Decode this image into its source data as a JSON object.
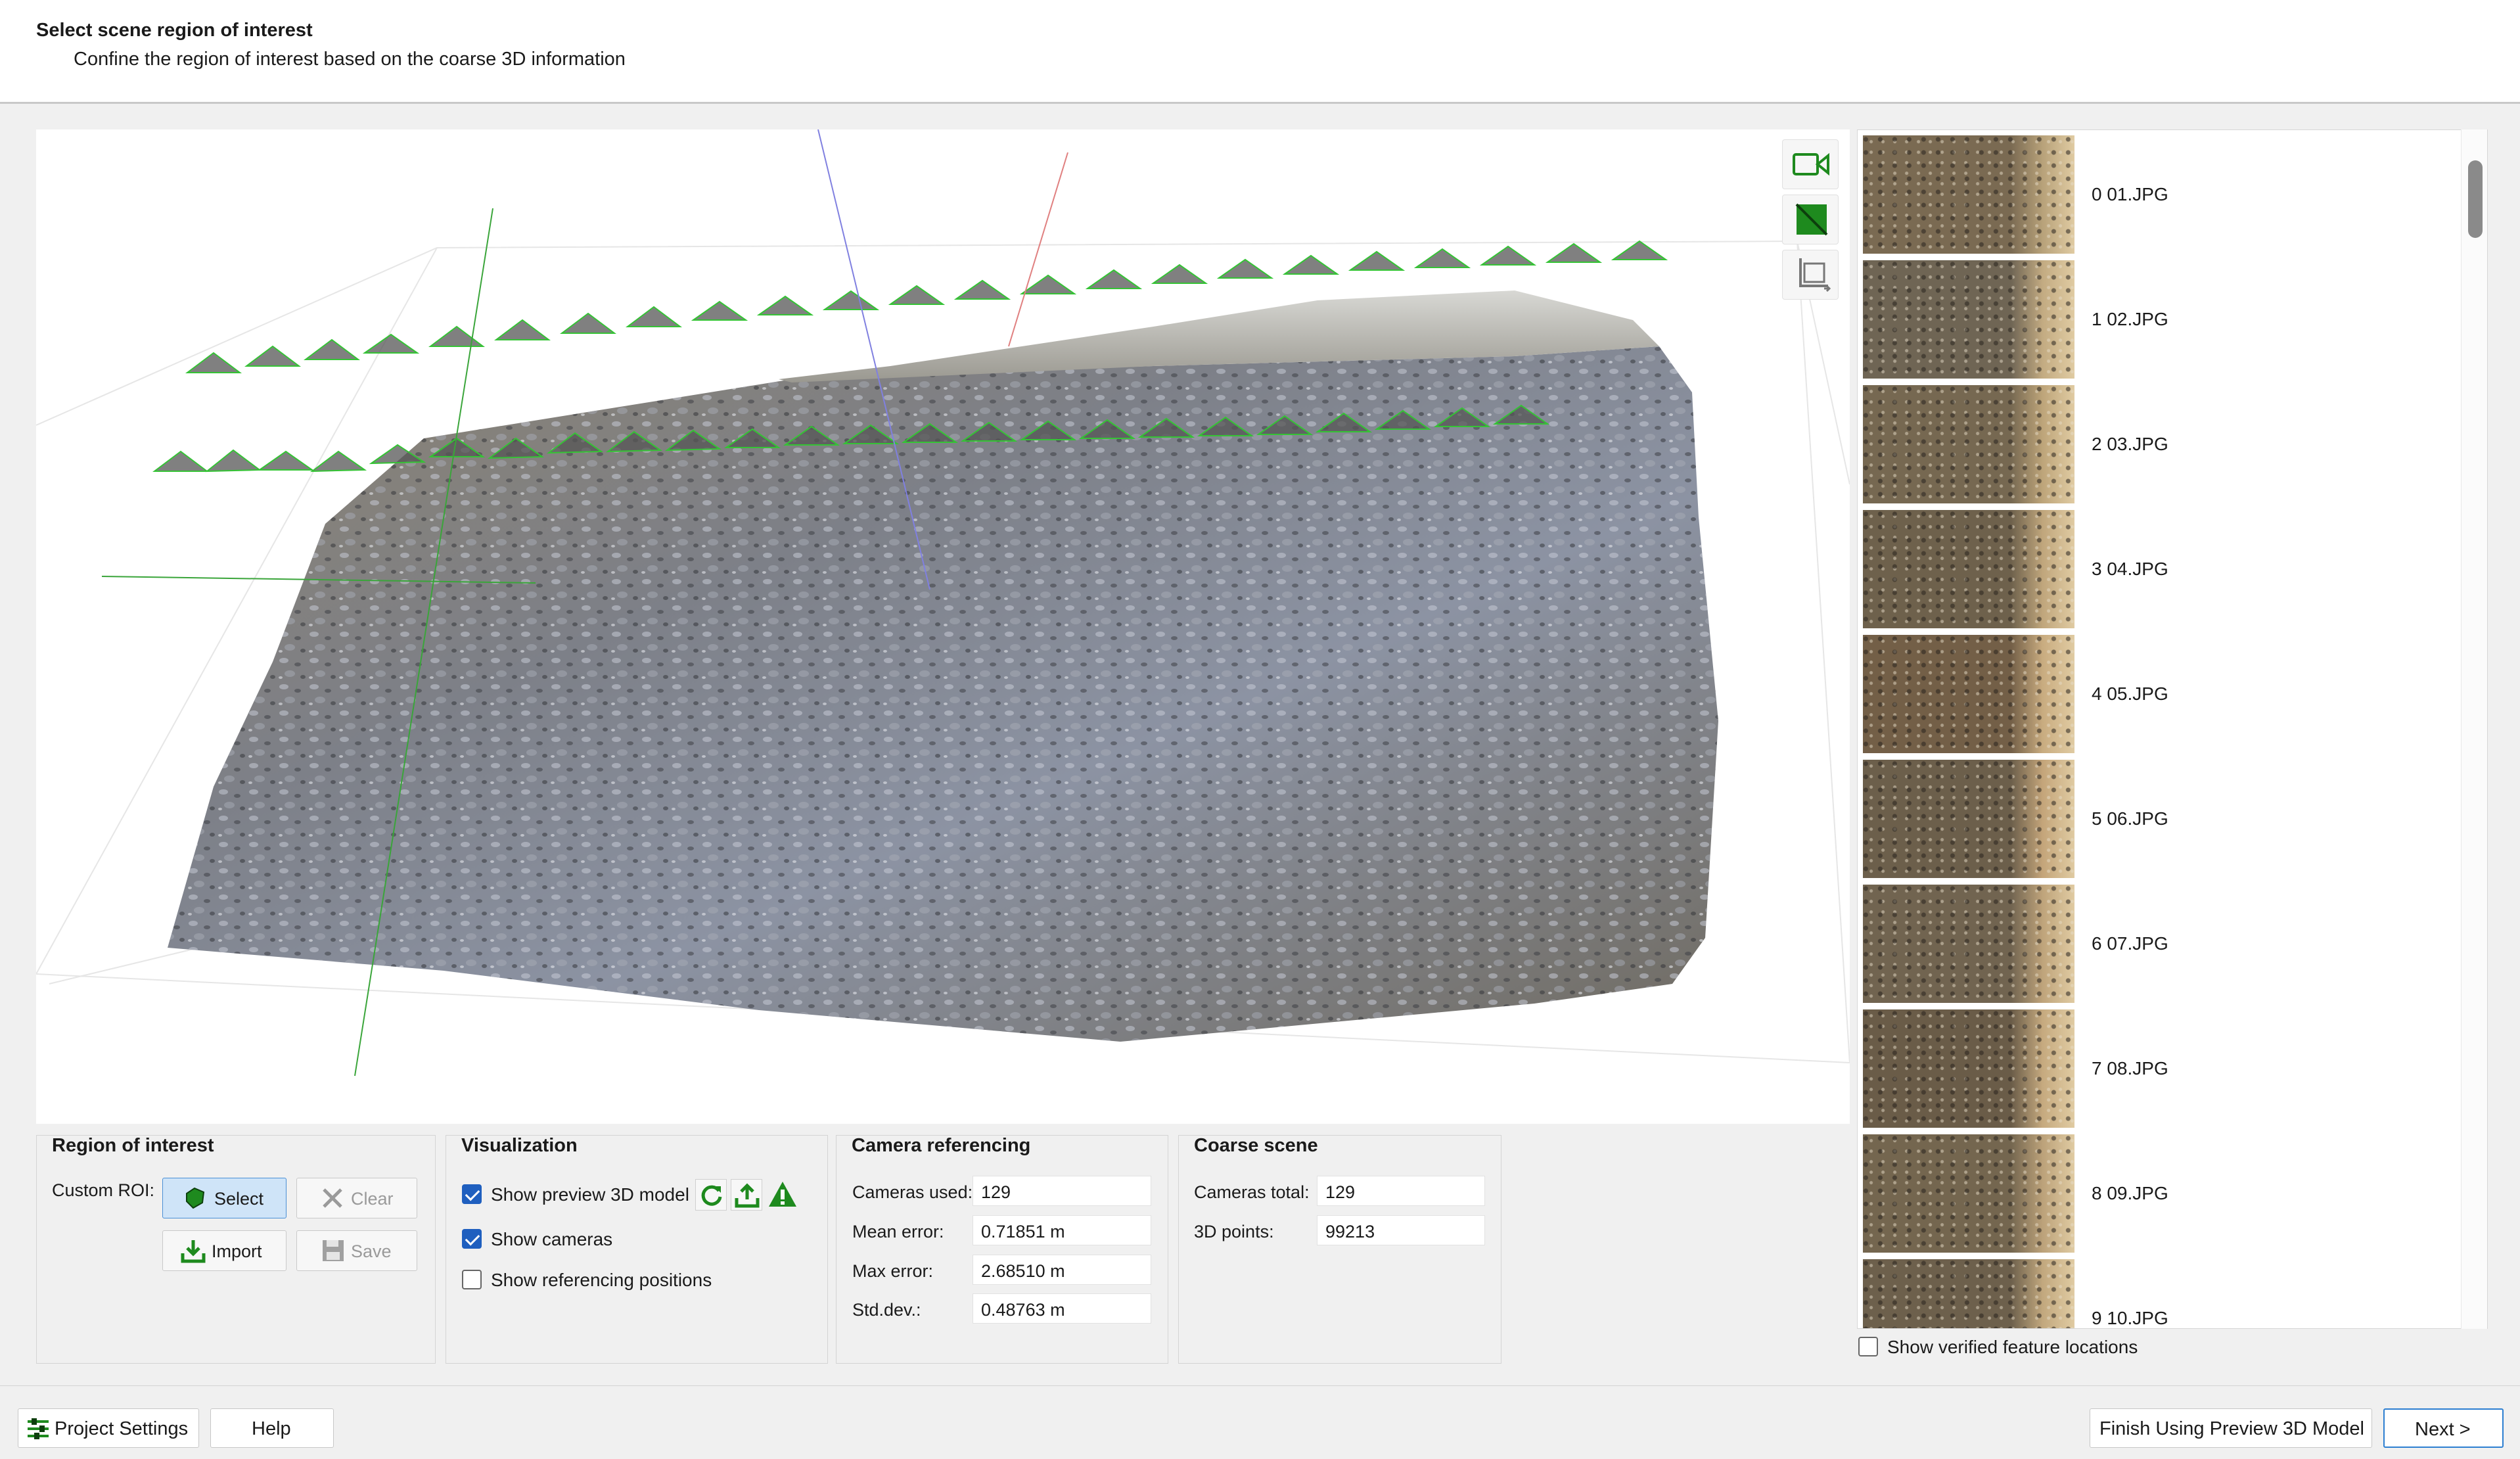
{
  "header": {
    "title": "Select scene region of interest",
    "subtitle": "Confine the region of interest based on the coarse 3D information"
  },
  "viewport": {
    "tools": [
      {
        "name": "camera-view-icon",
        "color": "#1e8a1e"
      },
      {
        "name": "texture-toggle-icon",
        "color": "#1e8a1e"
      },
      {
        "name": "crop-bounding-box-icon",
        "color": "#777777"
      }
    ]
  },
  "images": {
    "items": [
      {
        "label": "0 01.JPG"
      },
      {
        "label": "1 02.JPG"
      },
      {
        "label": "2 03.JPG"
      },
      {
        "label": "3 04.JPG"
      },
      {
        "label": "4 05.JPG"
      },
      {
        "label": "5 06.JPG"
      },
      {
        "label": "6 07.JPG"
      },
      {
        "label": "7 08.JPG"
      },
      {
        "label": "8 09.JPG"
      },
      {
        "label": "9 10.JPG"
      }
    ],
    "show_verified_label": "Show verified feature locations",
    "show_verified_checked": false
  },
  "roi": {
    "title": "Region of interest",
    "custom_label": "Custom ROI:",
    "select_label": "Select",
    "clear_label": "Clear",
    "import_label": "Import",
    "save_label": "Save"
  },
  "visualization": {
    "title": "Visualization",
    "show_preview_label": "Show preview 3D model",
    "show_preview_checked": true,
    "show_cameras_label": "Show cameras",
    "show_cameras_checked": true,
    "show_ref_label": "Show referencing positions",
    "show_ref_checked": false
  },
  "camera_ref": {
    "title": "Camera referencing",
    "cameras_used_label": "Cameras used:",
    "cameras_used": "129",
    "mean_error_label": "Mean error:",
    "mean_error": "0.71851 m",
    "max_error_label": "Max error:",
    "max_error": "2.68510 m",
    "std_dev_label": "Std.dev.:",
    "std_dev": "0.48763 m"
  },
  "coarse_scene": {
    "title": "Coarse scene",
    "cameras_total_label": "Cameras total:",
    "cameras_total": "129",
    "points_label": "3D points:",
    "points": "99213"
  },
  "footer": {
    "project_settings_label": "Project Settings",
    "help_label": "Help",
    "finish_label": "Finish Using Preview 3D Model",
    "next_label": "Next >"
  },
  "colors": {
    "accent_blue": "#1f5fbf",
    "icon_green": "#1e8a1e",
    "camera_frustum_green": "#2ecc40",
    "warning_green": "#1e8a1e"
  }
}
